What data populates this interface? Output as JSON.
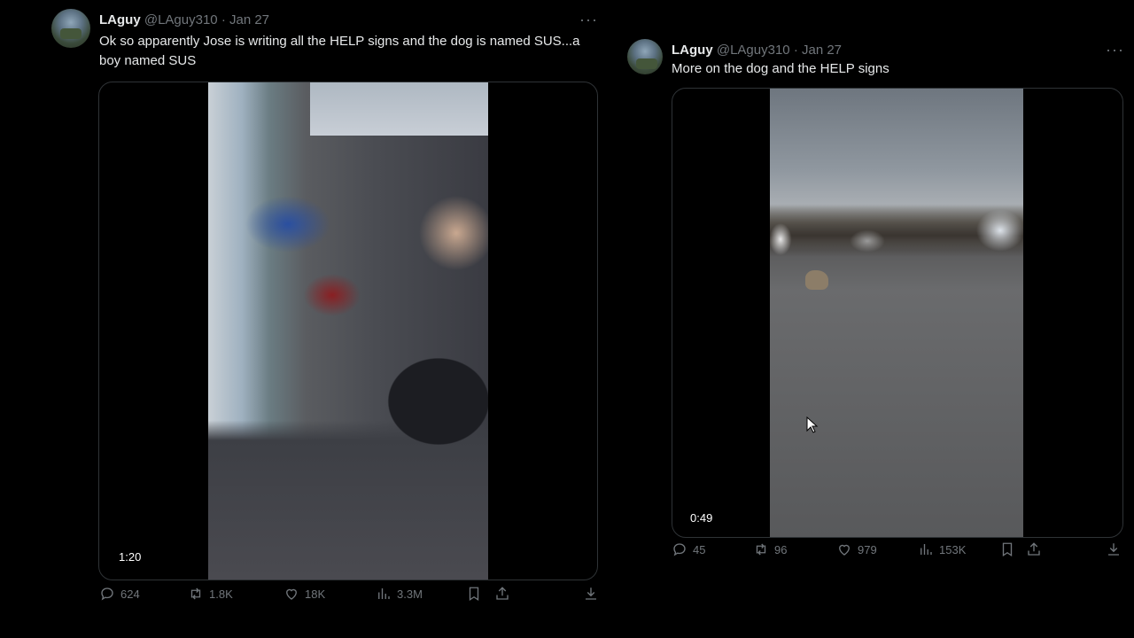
{
  "tweets": [
    {
      "name": "LAguy",
      "handle": "@LAguy310",
      "separator": "·",
      "date": "Jan 27",
      "more": "···",
      "text": "Ok so apparently Jose is writing all the HELP signs and the dog is named SUS...a boy named SUS",
      "video_duration": "1:20",
      "stats": {
        "replies": "624",
        "retweets": "1.8K",
        "likes": "18K",
        "views": "3.3M"
      }
    },
    {
      "name": "LAguy",
      "handle": "@LAguy310",
      "separator": "·",
      "date": "Jan 27",
      "more": "···",
      "text": "More on the dog and the HELP signs",
      "video_duration": "0:49",
      "stats": {
        "replies": "45",
        "retweets": "96",
        "likes": "979",
        "views": "153K"
      }
    }
  ],
  "icons": {
    "reply": "reply-icon",
    "retweet": "retweet-icon",
    "like": "heart-icon",
    "views": "views-icon",
    "bookmark": "bookmark-icon",
    "share": "share-icon",
    "download": "download-icon"
  },
  "colors": {
    "background": "#000000",
    "text": "#e7e9ea",
    "muted": "#71767b",
    "border": "#2f3336"
  }
}
